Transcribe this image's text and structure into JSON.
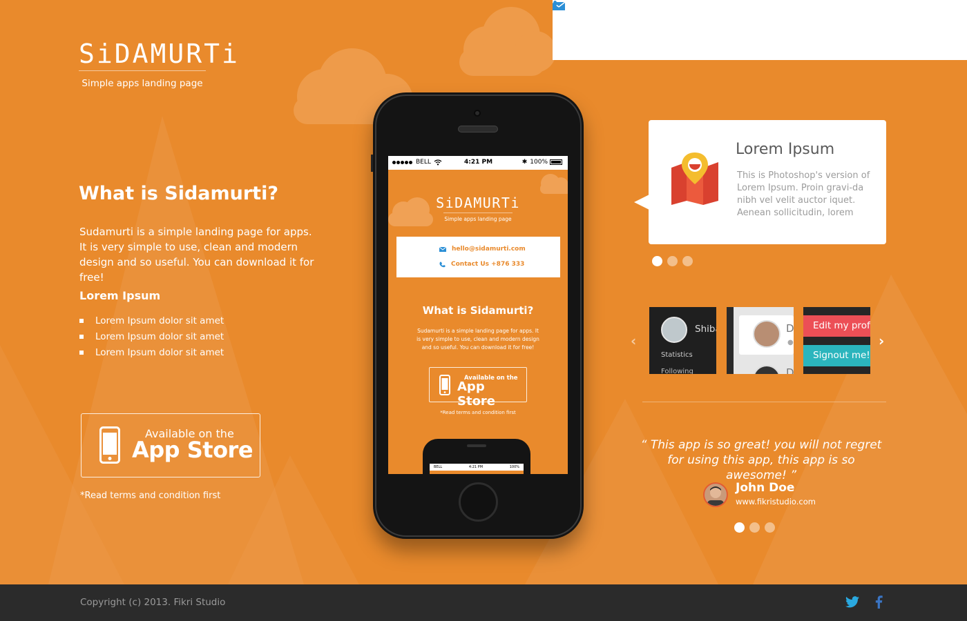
{
  "brand": {
    "logo": "SiDAMURTi",
    "tagline": "Simple apps landing page"
  },
  "contact": {
    "email": "hello@sidamurti.com",
    "phone": "Contact Us +876 333",
    "email_icon": "envelope-icon",
    "phone_icon": "phone-icon"
  },
  "intro": {
    "heading": "What is Sidamurti?",
    "text": "Sudamurti is a simple landing page for apps. It is very simple to use, clean and modern design and so useful. You can download it for free!",
    "subheading": "Lorem Ipsum",
    "bullets": [
      "Lorem Ipsum dolor sit amet",
      "Lorem Ipsum dolor sit amet",
      "Lorem Ipsum dolor sit amet"
    ]
  },
  "appstore": {
    "small": "Available on the",
    "big": "App Store",
    "terms": "*Read terms and condition first"
  },
  "mockup": {
    "status": {
      "carrier": "BELL",
      "time": "4:21 PM",
      "battery": "100%"
    },
    "logo": "SiDAMURTi",
    "tagline": "Simple apps landing page",
    "email": "hello@sidamurti.com",
    "phone": "Contact Us +876 333",
    "heading": "What is Sidamurti?",
    "text": "Sudamurti is a simple landing page for apps. It is very simple to use, clean and modern design and so useful. You can download it for free!",
    "store_small": "Available on the",
    "store_big": "App Store",
    "terms": "*Read terms and condition first",
    "mini_status": {
      "carrier": "BELL",
      "time": "4:21 PM",
      "battery": "100%"
    }
  },
  "feature": {
    "title": "Lorem Ipsum",
    "text": "This is Photoshop's version of Lorem Ipsum. Proin gravi-da nibh vel velit auctor iquet. Aenean sollicitudin, lorem",
    "icon": "map-pin-icon",
    "pager_active": 0,
    "pager_count": 3
  },
  "screens": {
    "thumb1_name": "Shiba",
    "thumb1_stat": "Statistics",
    "thumb1_follow": "Following",
    "thumb2_letter": "D",
    "thumb2_letter2": "D",
    "thumb3_edit": "Edit my profile",
    "thumb3_signout": "Signout me!"
  },
  "testimonial": {
    "quote": "“ This app is so great! you will not regret for using this app, this app is so awesome! ”",
    "name": "John Doe",
    "site": "www.fikristudio.com",
    "pager_active": 0,
    "pager_count": 3
  },
  "footer": {
    "copyright": "Copyright (c) 2013. Fikri Studio",
    "social": [
      "twitter-icon",
      "facebook-icon"
    ]
  },
  "colors": {
    "background": "#e98a2c",
    "accent_red": "#ec4f56",
    "accent_teal": "#2bb5bd",
    "footer": "#2b2b2b"
  }
}
